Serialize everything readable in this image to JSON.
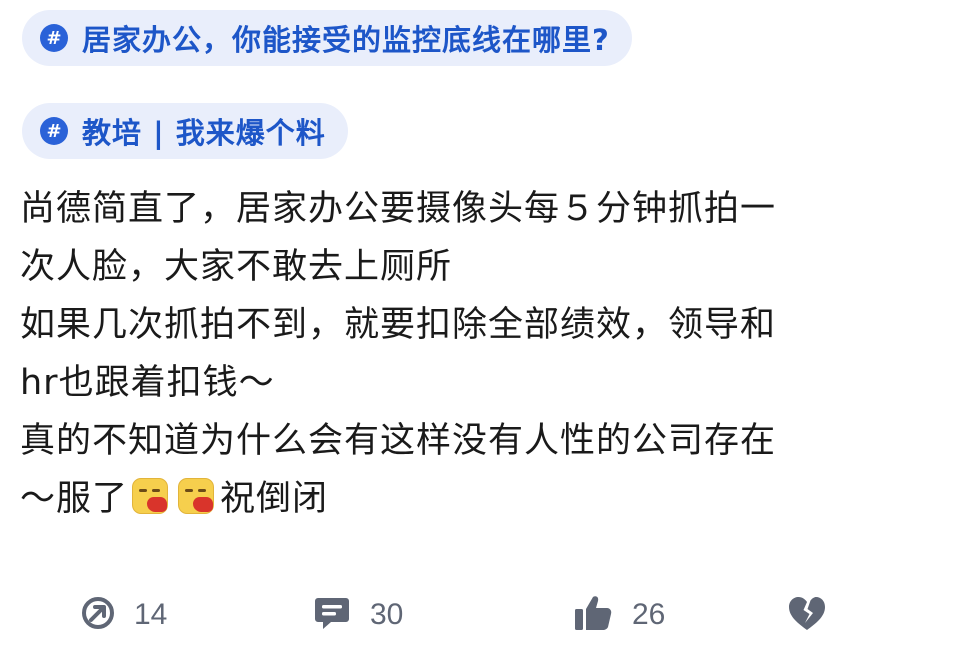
{
  "topics": [
    {
      "label": "居家办公，你能接受的监控底线在哪里?",
      "icon": "hash-icon"
    },
    {
      "label": "教培 | 我来爆个料",
      "icon": "hash-icon"
    }
  ],
  "post": {
    "lines": [
      "尚德简直了，居家办公要摄像头每５分钟抓拍一",
      "次人脸，大家不敢去上厕所",
      "如果几次抓拍不到，就要扣除全部绩效，领导和",
      "hr也跟着扣钱～",
      "真的不知道为什么会有这样没有人性的公司存在",
      "～服了",
      "祝倒闭"
    ],
    "emojis": [
      "angry-face-emoji",
      "angry-face-emoji"
    ]
  },
  "actions": {
    "share": {
      "icon": "share-icon",
      "count": "14"
    },
    "comment": {
      "icon": "comment-icon",
      "count": "30"
    },
    "like": {
      "icon": "thumbs-up-icon",
      "count": "26"
    },
    "dislike": {
      "icon": "broken-heart-icon"
    }
  },
  "colors": {
    "topic_bg": "#e9eefb",
    "topic_text": "#1d56c8",
    "hash_icon_bg": "#2a62d8",
    "body_text": "#1a1a1a",
    "action_gray": "#5f6675"
  }
}
